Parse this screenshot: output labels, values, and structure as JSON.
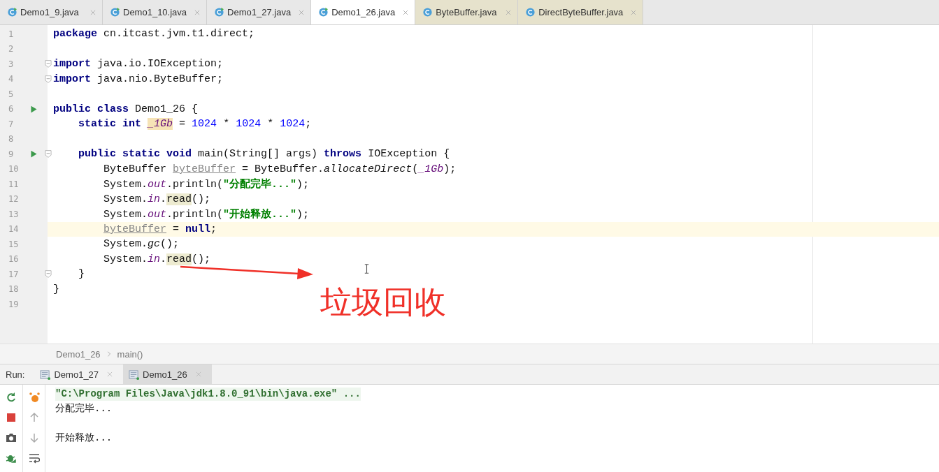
{
  "tabs": [
    {
      "label": "Demo1_9.java",
      "selected": false,
      "library": false
    },
    {
      "label": "Demo1_10.java",
      "selected": false,
      "library": false
    },
    {
      "label": "Demo1_27.java",
      "selected": false,
      "library": false
    },
    {
      "label": "Demo1_26.java",
      "selected": true,
      "library": false
    },
    {
      "label": "ByteBuffer.java",
      "selected": false,
      "library": true
    },
    {
      "label": "DirectByteBuffer.java",
      "selected": false,
      "library": true
    }
  ],
  "editor": {
    "lines": [
      {
        "number": "1",
        "tokens": [
          {
            "text": "package",
            "kind": "keyword"
          },
          {
            "text": " cn.itcast.jvm.t1.direct;",
            "kind": "plain"
          }
        ]
      },
      {
        "number": "2"
      },
      {
        "number": "3",
        "fold": true,
        "tokens": [
          {
            "text": "import",
            "kind": "keyword"
          },
          {
            "text": " java.io.IOException;",
            "kind": "plain"
          }
        ]
      },
      {
        "number": "4",
        "fold": true,
        "tokens": [
          {
            "text": "import",
            "kind": "keyword"
          },
          {
            "text": " java.nio.ByteBuffer;",
            "kind": "plain"
          }
        ]
      },
      {
        "number": "5"
      },
      {
        "number": "6",
        "run": true,
        "tokens": [
          {
            "text": "public class",
            "kind": "keyword"
          },
          {
            "text": " Demo1_26 {",
            "kind": "plain"
          }
        ]
      },
      {
        "number": "7",
        "tokens": [
          {
            "text": "    static int ",
            "kind": "keyword"
          },
          {
            "text": "_1Gb",
            "kind": "field-usage"
          },
          {
            "text": " = ",
            "kind": "plain"
          },
          {
            "text": "1024",
            "kind": "number"
          },
          {
            "text": " * ",
            "kind": "plain"
          },
          {
            "text": "1024",
            "kind": "number"
          },
          {
            "text": " * ",
            "kind": "plain"
          },
          {
            "text": "1024",
            "kind": "number"
          },
          {
            "text": ";",
            "kind": "plain"
          }
        ]
      },
      {
        "number": "8"
      },
      {
        "number": "9",
        "run": true,
        "fold": true,
        "tokens": [
          {
            "text": "    public static void",
            "kind": "keyword"
          },
          {
            "text": " main(String[] args) ",
            "kind": "plain"
          },
          {
            "text": "throws",
            "kind": "keyword"
          },
          {
            "text": " IOException {",
            "kind": "plain"
          }
        ]
      },
      {
        "number": "10",
        "tokens": [
          {
            "text": "        ByteBuffer ",
            "kind": "plain"
          },
          {
            "text": "byteBuffer",
            "kind": "unused"
          },
          {
            "text": " = ByteBuffer.",
            "kind": "plain"
          },
          {
            "text": "allocateDirect",
            "kind": "italic"
          },
          {
            "text": "(",
            "kind": "plain"
          },
          {
            "text": "_1Gb",
            "kind": "field"
          },
          {
            "text": ");",
            "kind": "plain"
          }
        ]
      },
      {
        "number": "11",
        "tokens": [
          {
            "text": "        System.",
            "kind": "plain"
          },
          {
            "text": "out",
            "kind": "field"
          },
          {
            "text": ".println(",
            "kind": "plain"
          },
          {
            "text": "\"分配完毕...\"",
            "kind": "string"
          },
          {
            "text": ");",
            "kind": "plain"
          }
        ]
      },
      {
        "number": "12",
        "tokens": [
          {
            "text": "        System.",
            "kind": "plain"
          },
          {
            "text": "in",
            "kind": "field"
          },
          {
            "text": ".",
            "kind": "plain"
          },
          {
            "text": "read",
            "kind": "usage"
          },
          {
            "text": "();",
            "kind": "plain"
          }
        ]
      },
      {
        "number": "13",
        "tokens": [
          {
            "text": "        System.",
            "kind": "plain"
          },
          {
            "text": "out",
            "kind": "field"
          },
          {
            "text": ".println(",
            "kind": "plain"
          },
          {
            "text": "\"开始释放...\"",
            "kind": "string"
          },
          {
            "text": ");",
            "kind": "plain"
          }
        ]
      },
      {
        "number": "14",
        "current": true,
        "tokens": [
          {
            "text": "        byteBuffer",
            "kind": "unused"
          },
          {
            "text": " = ",
            "kind": "plain"
          },
          {
            "text": "null",
            "kind": "keyword"
          },
          {
            "text": ";",
            "kind": "plain"
          }
        ]
      },
      {
        "number": "15",
        "tokens": [
          {
            "text": "        System.",
            "kind": "plain"
          },
          {
            "text": "gc",
            "kind": "italic"
          },
          {
            "text": "();",
            "kind": "plain"
          }
        ]
      },
      {
        "number": "16",
        "tokens": [
          {
            "text": "        System.",
            "kind": "plain"
          },
          {
            "text": "in",
            "kind": "field"
          },
          {
            "text": ".",
            "kind": "plain"
          },
          {
            "text": "read",
            "kind": "usage"
          },
          {
            "text": "();",
            "kind": "plain"
          }
        ]
      },
      {
        "number": "17",
        "fold": true,
        "tokens": [
          {
            "text": "    }",
            "kind": "plain"
          }
        ]
      },
      {
        "number": "18",
        "tokens": [
          {
            "text": "}",
            "kind": "plain"
          }
        ]
      },
      {
        "number": "19"
      }
    ],
    "annotation": {
      "text": "垃圾回收"
    }
  },
  "breadcrumb": [
    "Demo1_26",
    "main()"
  ],
  "run_panel": {
    "label": "Run:",
    "tabs": [
      {
        "label": "Demo1_27",
        "selected": false
      },
      {
        "label": "Demo1_26",
        "selected": true
      }
    ],
    "console": [
      {
        "kind": "command",
        "text": "\"C:\\Program Files\\Java\\jdk1.8.0_91\\bin\\java.exe\" ..."
      },
      {
        "kind": "output",
        "text": "分配完毕..."
      },
      {
        "kind": "blank"
      },
      {
        "kind": "output",
        "text": "开始释放..."
      }
    ]
  }
}
